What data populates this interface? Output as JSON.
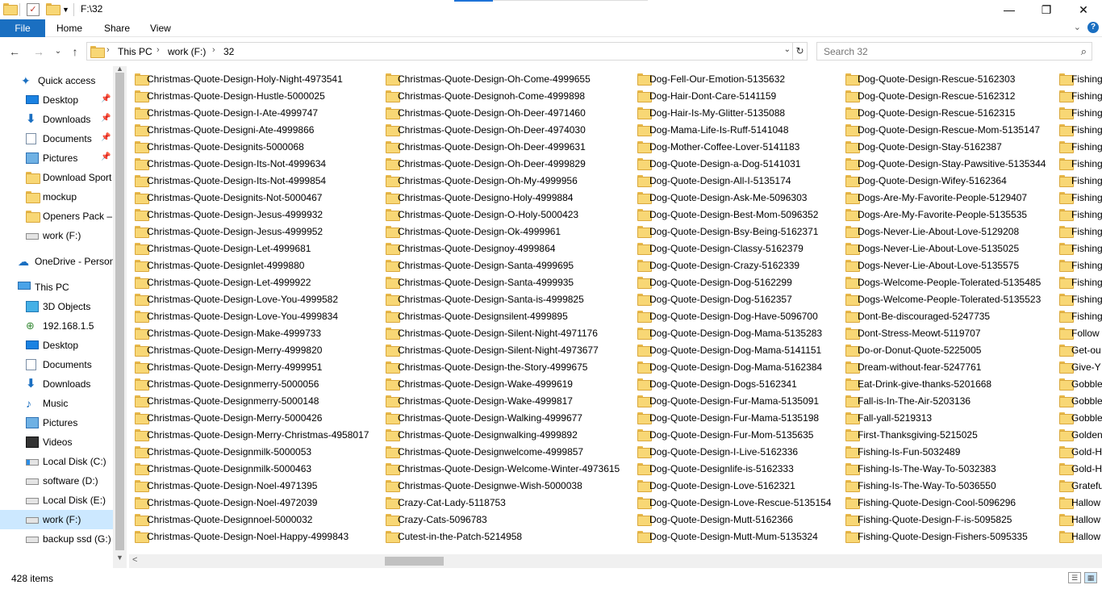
{
  "titlebar": {
    "path": "F:\\32",
    "minimize": "—",
    "restore": "❐",
    "close": "✕"
  },
  "ribbon": {
    "tabs": [
      "File",
      "Home",
      "Share",
      "View"
    ],
    "expand": "⌄",
    "help": "?"
  },
  "nav": {
    "back": "←",
    "forward": "→",
    "recent": "⌄",
    "up": "↑",
    "crumbs": [
      "This PC",
      "work (F:)",
      "32"
    ],
    "sep": "›",
    "dropdown": "⌄",
    "refresh": "↻"
  },
  "search": {
    "placeholder": "Search 32",
    "icon": "⌕"
  },
  "sidebar": {
    "items": [
      {
        "label": "Quick access",
        "icon": "star-icon"
      },
      {
        "label": "Desktop",
        "icon": "desktop-icon",
        "pin": "📌"
      },
      {
        "label": "Downloads",
        "icon": "download-icon",
        "pin": "📌"
      },
      {
        "label": "Documents",
        "icon": "documents-icon",
        "pin": "📌"
      },
      {
        "label": "Pictures",
        "icon": "pictures-icon",
        "pin": "📌"
      },
      {
        "label": "Download Sport",
        "icon": "folder-icon"
      },
      {
        "label": "mockup",
        "icon": "folder-icon"
      },
      {
        "label": "Openers Pack – V",
        "icon": "folder-icon"
      },
      {
        "label": "work (F:)",
        "icon": "drive-icon"
      },
      {
        "label": "OneDrive - Person",
        "icon": "cloud-icon"
      },
      {
        "label": "This PC",
        "icon": "computer-icon"
      },
      {
        "label": "3D Objects",
        "icon": "3d-objects-icon"
      },
      {
        "label": "192.168.1.5",
        "icon": "network-icon"
      },
      {
        "label": "Desktop",
        "icon": "desktop-icon"
      },
      {
        "label": "Documents",
        "icon": "documents-icon"
      },
      {
        "label": "Downloads",
        "icon": "download-icon"
      },
      {
        "label": "Music",
        "icon": "music-icon"
      },
      {
        "label": "Pictures",
        "icon": "pictures-icon"
      },
      {
        "label": "Videos",
        "icon": "videos-icon"
      },
      {
        "label": "Local Disk (C:)",
        "icon": "system-drive-icon"
      },
      {
        "label": "software (D:)",
        "icon": "drive-icon"
      },
      {
        "label": "Local Disk (E:)",
        "icon": "drive-icon"
      },
      {
        "label": "work (F:)",
        "icon": "drive-icon"
      },
      {
        "label": "backup ssd (G:)",
        "icon": "drive-icon"
      }
    ],
    "scroll_up": "▲",
    "scroll_down": "▼"
  },
  "columns": [
    [
      "Christmas-Quote-Design-Holy-Night-4973541",
      "Christmas-Quote-Design-Hustle-5000025",
      "Christmas-Quote-Design-I-Ate-4999747",
      "Christmas-Quote-Designi-Ate-4999866",
      "Christmas-Quote-Designits-5000068",
      "Christmas-Quote-Design-Its-Not-4999634",
      "Christmas-Quote-Design-Its-Not-4999854",
      "Christmas-Quote-Designits-Not-5000467",
      "Christmas-Quote-Design-Jesus-4999932",
      "Christmas-Quote-Design-Jesus-4999952",
      "Christmas-Quote-Design-Let-4999681",
      "Christmas-Quote-Designlet-4999880",
      "Christmas-Quote-Design-Let-4999922",
      "Christmas-Quote-Design-Love-You-4999582",
      "Christmas-Quote-Design-Love-You-4999834",
      "Christmas-Quote-Design-Make-4999733",
      "Christmas-Quote-Design-Merry-4999820",
      "Christmas-Quote-Design-Merry-4999951",
      "Christmas-Quote-Designmerry-5000056",
      "Christmas-Quote-Designmerry-5000148",
      "Christmas-Quote-Design-Merry-5000426",
      "Christmas-Quote-Design-Merry-Christmas-4958017",
      "Christmas-Quote-Designmilk-5000053",
      "Christmas-Quote-Designmilk-5000463",
      "Christmas-Quote-Design-Noel-4971395",
      "Christmas-Quote-Design-Noel-4972039",
      "Christmas-Quote-Designnoel-5000032",
      "Christmas-Quote-Design-Noel-Happy-4999843"
    ],
    [
      "Christmas-Quote-Design-Oh-Come-4999655",
      "Christmas-Quote-Designoh-Come-4999898",
      "Christmas-Quote-Design-Oh-Deer-4971460",
      "Christmas-Quote-Design-Oh-Deer-4974030",
      "Christmas-Quote-Design-Oh-Deer-4999631",
      "Christmas-Quote-Design-Oh-Deer-4999829",
      "Christmas-Quote-Design-Oh-My-4999956",
      "Christmas-Quote-Designo-Holy-4999884",
      "Christmas-Quote-Design-O-Holy-5000423",
      "Christmas-Quote-Design-Ok-4999961",
      "Christmas-Quote-Designoy-4999864",
      "Christmas-Quote-Design-Santa-4999695",
      "Christmas-Quote-Design-Santa-4999935",
      "Christmas-Quote-Design-Santa-is-4999825",
      "Christmas-Quote-Designsilent-4999895",
      "Christmas-Quote-Design-Silent-Night-4971176",
      "Christmas-Quote-Design-Silent-Night-4973677",
      "Christmas-Quote-Design-the-Story-4999675",
      "Christmas-Quote-Design-Wake-4999619",
      "Christmas-Quote-Design-Wake-4999817",
      "Christmas-Quote-Design-Walking-4999677",
      "Christmas-Quote-Designwalking-4999892",
      "Christmas-Quote-Designwelcome-4999857",
      "Christmas-Quote-Design-Welcome-Winter-4973615",
      "Christmas-Quote-Designwe-Wish-5000038",
      "Crazy-Cat-Lady-5118753",
      "Crazy-Cats-5096783",
      "Cutest-in-the-Patch-5214958"
    ],
    [
      "Dog-Fell-Our-Emotion-5135632",
      "Dog-Hair-Dont-Care-5141159",
      "Dog-Hair-Is-My-Glitter-5135088",
      "Dog-Mama-Life-Is-Ruff-5141048",
      "Dog-Mother-Coffee-Lover-5141183",
      "Dog-Quote-Design-a-Dog-5141031",
      "Dog-Quote-Design-All-I-5135174",
      "Dog-Quote-Design-Ask-Me-5096303",
      "Dog-Quote-Design-Best-Mom-5096352",
      "Dog-Quote-Design-Bsy-Being-5162371",
      "Dog-Quote-Design-Classy-5162379",
      "Dog-Quote-Design-Crazy-5162339",
      "Dog-Quote-Design-Dog-5162299",
      "Dog-Quote-Design-Dog-5162357",
      "Dog-Quote-Design-Dog-Have-5096700",
      "Dog-Quote-Design-Dog-Mama-5135283",
      "Dog-Quote-Design-Dog-Mama-5141151",
      "Dog-Quote-Design-Dog-Mama-5162384",
      "Dog-Quote-Design-Dogs-5162341",
      "Dog-Quote-Design-Fur-Mama-5135091",
      "Dog-Quote-Design-Fur-Mama-5135198",
      "Dog-Quote-Design-Fur-Mom-5135635",
      "Dog-Quote-Design-I-Live-5162336",
      "Dog-Quote-Designlife-is-5162333",
      "Dog-Quote-Design-Love-5162321",
      "Dog-Quote-Design-Love-Rescue-5135154",
      "Dog-Quote-Design-Mutt-5162366",
      "Dog-Quote-Design-Mutt-Mum-5135324"
    ],
    [
      "Dog-Quote-Design-Rescue-5162303",
      "Dog-Quote-Design-Rescue-5162312",
      "Dog-Quote-Design-Rescue-5162315",
      "Dog-Quote-Design-Rescue-Mom-5135147",
      "Dog-Quote-Design-Stay-5162387",
      "Dog-Quote-Design-Stay-Pawsitive-5135344",
      "Dog-Quote-Design-Wifey-5162364",
      "Dogs-Are-My-Favorite-People-5129407",
      "Dogs-Are-My-Favorite-People-5135535",
      "Dogs-Never-Lie-About-Love-5129208",
      "Dogs-Never-Lie-About-Love-5135025",
      "Dogs-Never-Lie-About-Love-5135575",
      "Dogs-Welcome-People-Tolerated-5135485",
      "Dogs-Welcome-People-Tolerated-5135523",
      "Dont-Be-discouraged-5247735",
      "Dont-Stress-Meowt-5119707",
      "Do-or-Donut-Quote-5225005",
      "Dream-without-fear-5247761",
      "Eat-Drink-give-thanks-5201668",
      "Fall-is-In-The-Air-5203136",
      "Fall-yall-5219313",
      "First-Thanksgiving-5215025",
      "Fishing-Is-Fun-5032489",
      "Fishing-Is-The-Way-To-5032383",
      "Fishing-Is-The-Way-To-5036550",
      "Fishing-Quote-Design-Cool-5096296",
      "Fishing-Quote-Design-F-is-5095825",
      "Fishing-Quote-Design-Fishers-5095335"
    ],
    [
      "Fishing",
      "Fishing",
      "Fishing",
      "Fishing",
      "Fishing",
      "Fishing",
      "Fishing",
      "Fishing",
      "Fishing",
      "Fishing",
      "Fishing",
      "Fishing",
      "Fishing",
      "Fishing",
      "Fishing",
      "Follow",
      "Get-ou",
      "Give-Y",
      "Gobble",
      "Gobble",
      "Gobble",
      "Golden",
      "Gold-H",
      "Gold-H",
      "Gratefu",
      "Hallow",
      "Hallow",
      "Hallow"
    ]
  ],
  "hscroll": {
    "left_arrow": "<"
  },
  "status": {
    "count": "428 items",
    "details_icon": "☰",
    "tiles_icon": "▦"
  }
}
